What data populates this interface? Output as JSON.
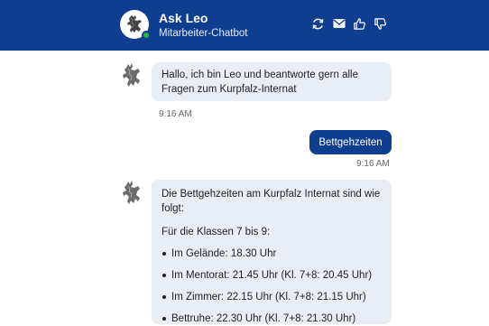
{
  "header": {
    "title": "Ask Leo",
    "subtitle": "Mitarbeiter-Chatbot",
    "icons": [
      "refresh-icon",
      "mail-icon",
      "thumbs-up-icon",
      "thumbs-down-icon"
    ],
    "background": "#0f3d8f",
    "status_color": "#2fb344"
  },
  "messages": [
    {
      "role": "bot",
      "text": "Hallo, ich bin Leo und beantworte gern alle Fragen zum Kurpfalz-Internat",
      "time": "9:16 AM"
    },
    {
      "role": "user",
      "text": "Bettgehzeiten",
      "time": "9:16 AM"
    },
    {
      "role": "bot",
      "intro": "Die Bettgehzeiten am Kurpfalz Internat sind wie folgt:",
      "group_heading": "Für die Klassen 7 bis 9:",
      "items": [
        "Im Gelände: 18.30 Uhr",
        "Im Mentorat: 21.45 Uhr (Kl. 7+8: 20.45 Uhr)",
        "Im Zimmer: 22.15 Uhr (Kl. 7+8: 21.15 Uhr)",
        "Bettruhe: 22.30 Uhr (Kl. 7+8: 21.30 Uhr)"
      ]
    }
  ]
}
